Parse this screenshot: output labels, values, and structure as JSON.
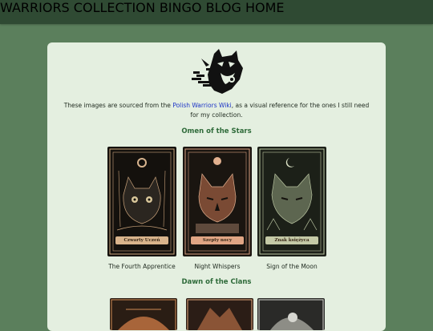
{
  "nav": {
    "items": [
      "WARRIORS COLLECTION",
      "BINGO",
      "BLOG",
      "HOME"
    ]
  },
  "logo": {
    "icon": "cat-emblem-icon"
  },
  "intro": {
    "before": "These images are sourced from the ",
    "link": "Polish Warriors Wiki",
    "after": ", as a visual reference for the ones I still need for my collection."
  },
  "sections": [
    {
      "title": "Omen of the Stars",
      "cards": [
        {
          "label": "Czwarty Uczeń",
          "caption": "The Fourth Apprentice"
        },
        {
          "label": "Szepty nocy",
          "caption": "Night Whispers"
        },
        {
          "label": "Znak księżyca",
          "caption": "Sign of the Moon"
        }
      ]
    },
    {
      "title": "Dawn of the Clans",
      "cards": []
    }
  ],
  "colors": {
    "page_bg": "#5b7f5c",
    "topbar": "#2f4a33",
    "card_bg": "#e4efe0",
    "section_title": "#2f6b3a",
    "link": "#1d35c7"
  }
}
